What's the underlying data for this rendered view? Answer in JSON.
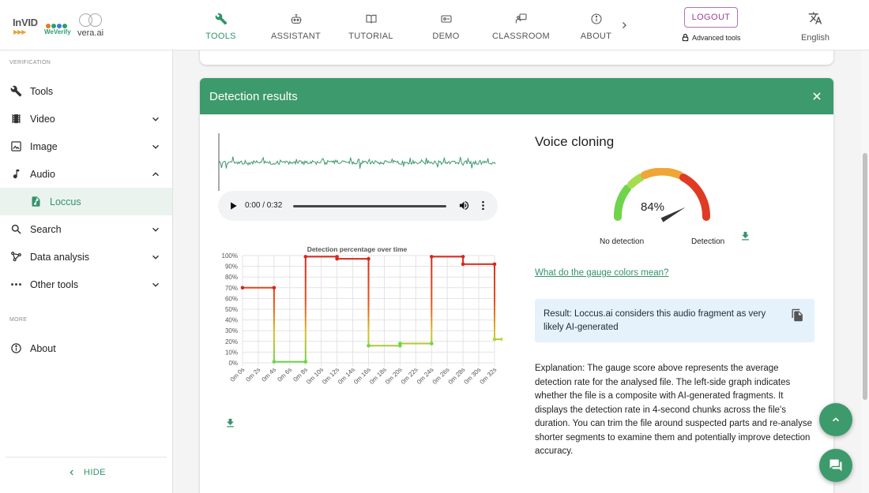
{
  "header": {
    "logos": {
      "invid": "InVID",
      "weverify": "WeVerify",
      "vera": "vera.ai"
    },
    "nav": [
      {
        "id": "tools",
        "label": "TOOLS",
        "icon": "wrench-icon",
        "active": true
      },
      {
        "id": "assistant",
        "label": "ASSISTANT",
        "icon": "robot-icon",
        "active": false
      },
      {
        "id": "tutorial",
        "label": "TUTORIAL",
        "icon": "book-icon",
        "active": false
      },
      {
        "id": "demo",
        "label": "DEMO",
        "icon": "video-icon",
        "active": false
      },
      {
        "id": "classroom",
        "label": "CLASSROOM",
        "icon": "classroom-icon",
        "active": false
      },
      {
        "id": "about",
        "label": "ABOUT",
        "icon": "info-icon",
        "active": false
      }
    ],
    "logout_label": "LOGOUT",
    "advanced_label": "Advanced tools",
    "language_label": "English"
  },
  "sidebar": {
    "section_verification": "VERIFICATION",
    "section_more": "MORE",
    "items": [
      {
        "label": "Tools",
        "icon": "wrench-icon"
      },
      {
        "label": "Video",
        "icon": "film-icon",
        "chevron": "down"
      },
      {
        "label": "Image",
        "icon": "image-icon",
        "chevron": "down"
      },
      {
        "label": "Audio",
        "icon": "music-note-icon",
        "chevron": "up"
      },
      {
        "label": "Loccus",
        "icon": "audio-file-icon",
        "selected": true
      },
      {
        "label": "Search",
        "icon": "search-icon",
        "chevron": "down"
      },
      {
        "label": "Data analysis",
        "icon": "network-icon",
        "chevron": "down"
      },
      {
        "label": "Other tools",
        "icon": "more-dots-icon",
        "chevron": "down"
      }
    ],
    "about_label": "About",
    "hide_label": "HIDE"
  },
  "results": {
    "title": "Detection results",
    "player": {
      "time": "0:00 / 0:32"
    },
    "voice_cloning_title": "Voice cloning",
    "gauge": {
      "value": 84,
      "value_label": "84%",
      "low_label": "No detection",
      "high_label": "Detection"
    },
    "gauge_link": "What do the gauge colors mean?",
    "result_text": "Result: Loccus.ai considers this audio fragment as very likely AI-generated",
    "explanation": "Explanation: The gauge score above represents the average detection rate for the analysed file. The left-side graph indicates whether the file is a composite with AI-generated fragments. It displays the detection rate in 4-second chunks across the file's duration. You can trim the file around suspected parts and re-analyse shorter segments to examine them and potentially improve detection accuracy."
  },
  "chart_data": {
    "type": "line",
    "title": "Detection percentage over time",
    "xlabel": "",
    "ylabel": "",
    "x_labels": [
      "0m 0s",
      "0m 2s",
      "0m 4s",
      "0m 6s",
      "0m 8s",
      "0m 10s",
      "0m 12s",
      "0m 14s",
      "0m 16s",
      "0m 18s",
      "0m 20s",
      "0m 22s",
      "0m 24s",
      "0m 26s",
      "0m 28s",
      "0m 30s",
      "0m 32s"
    ],
    "y_labels": [
      "100%",
      "90%",
      "80%",
      "70%",
      "60%",
      "50%",
      "40%",
      "30%",
      "20%",
      "10%",
      "0%"
    ],
    "ylim": [
      0,
      100
    ],
    "xlim": [
      0,
      32
    ],
    "grid": true,
    "points": [
      [
        0,
        70
      ],
      [
        4,
        70
      ],
      [
        4,
        1
      ],
      [
        8,
        1
      ],
      [
        8,
        99
      ],
      [
        12,
        99
      ],
      [
        12,
        97
      ],
      [
        16,
        97
      ],
      [
        16,
        16
      ],
      [
        20,
        16
      ],
      [
        20,
        18
      ],
      [
        24,
        18
      ],
      [
        24,
        99
      ],
      [
        28,
        99
      ],
      [
        28,
        92
      ],
      [
        32,
        92
      ],
      [
        32,
        22
      ],
      [
        33,
        22
      ]
    ],
    "colors": {
      "high": "#d9261c",
      "low": "#6fd44a"
    }
  }
}
